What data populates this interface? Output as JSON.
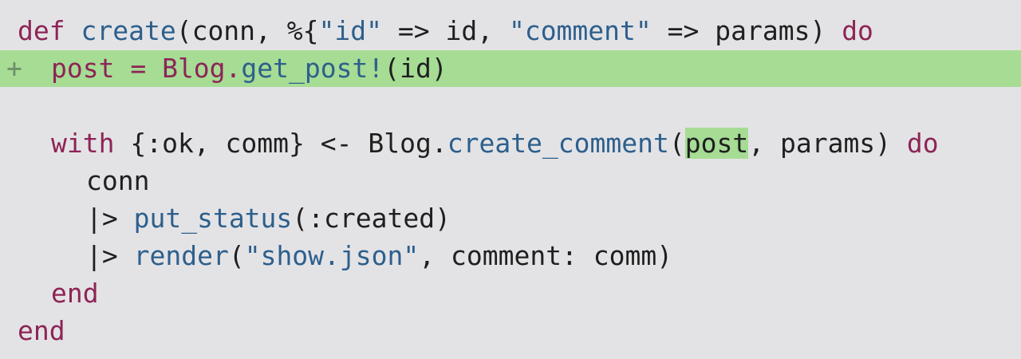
{
  "editor": {
    "lines": [
      {
        "tokens": [
          {
            "t": "def",
            "c": "kw"
          },
          {
            "t": " ",
            "c": ""
          },
          {
            "t": "create",
            "c": "fn"
          },
          {
            "t": "(conn, %{",
            "c": ""
          },
          {
            "t": "\"id\"",
            "c": "str"
          },
          {
            "t": " => id, ",
            "c": ""
          },
          {
            "t": "\"comment\"",
            "c": "str"
          },
          {
            "t": " => params) ",
            "c": ""
          },
          {
            "t": "do",
            "c": "kw"
          }
        ]
      },
      {
        "tokens": [
          {
            "t": "post = Blog.",
            "c": "kw"
          },
          {
            "t": "get_post!",
            "c": "fn"
          },
          {
            "t": "(id)",
            "c": ""
          }
        ]
      },
      {
        "tokens": [
          {
            "t": "",
            "c": ""
          }
        ]
      },
      {
        "tokens": [
          {
            "t": "with",
            "c": "kw"
          },
          {
            "t": " {:ok, comm} <- Blog.",
            "c": ""
          },
          {
            "t": "create_comment",
            "c": "fn"
          },
          {
            "t": "(",
            "c": ""
          },
          {
            "t": "post",
            "c": "hl"
          },
          {
            "t": ", params) ",
            "c": ""
          },
          {
            "t": "do",
            "c": "kw"
          }
        ]
      },
      {
        "tokens": [
          {
            "t": "conn",
            "c": ""
          }
        ]
      },
      {
        "tokens": [
          {
            "t": "|> ",
            "c": ""
          },
          {
            "t": "put_status",
            "c": "fn"
          },
          {
            "t": "(:created)",
            "c": ""
          }
        ]
      },
      {
        "tokens": [
          {
            "t": "|> ",
            "c": ""
          },
          {
            "t": "render",
            "c": "fn"
          },
          {
            "t": "(",
            "c": ""
          },
          {
            "t": "\"show.json\"",
            "c": "str"
          },
          {
            "t": ", comment: comm)",
            "c": ""
          }
        ]
      },
      {
        "tokens": [
          {
            "t": "end",
            "c": "kw"
          }
        ]
      },
      {
        "tokens": [
          {
            "t": "end",
            "c": "kw"
          }
        ]
      }
    ],
    "added_marker": "+"
  },
  "colors": {
    "background": "#e3e3e6",
    "added_line": "#a6dc94",
    "keyword": "#8d2456",
    "function": "#2d5f8c",
    "string": "#2d5f8c",
    "text": "#1f1f1f"
  }
}
